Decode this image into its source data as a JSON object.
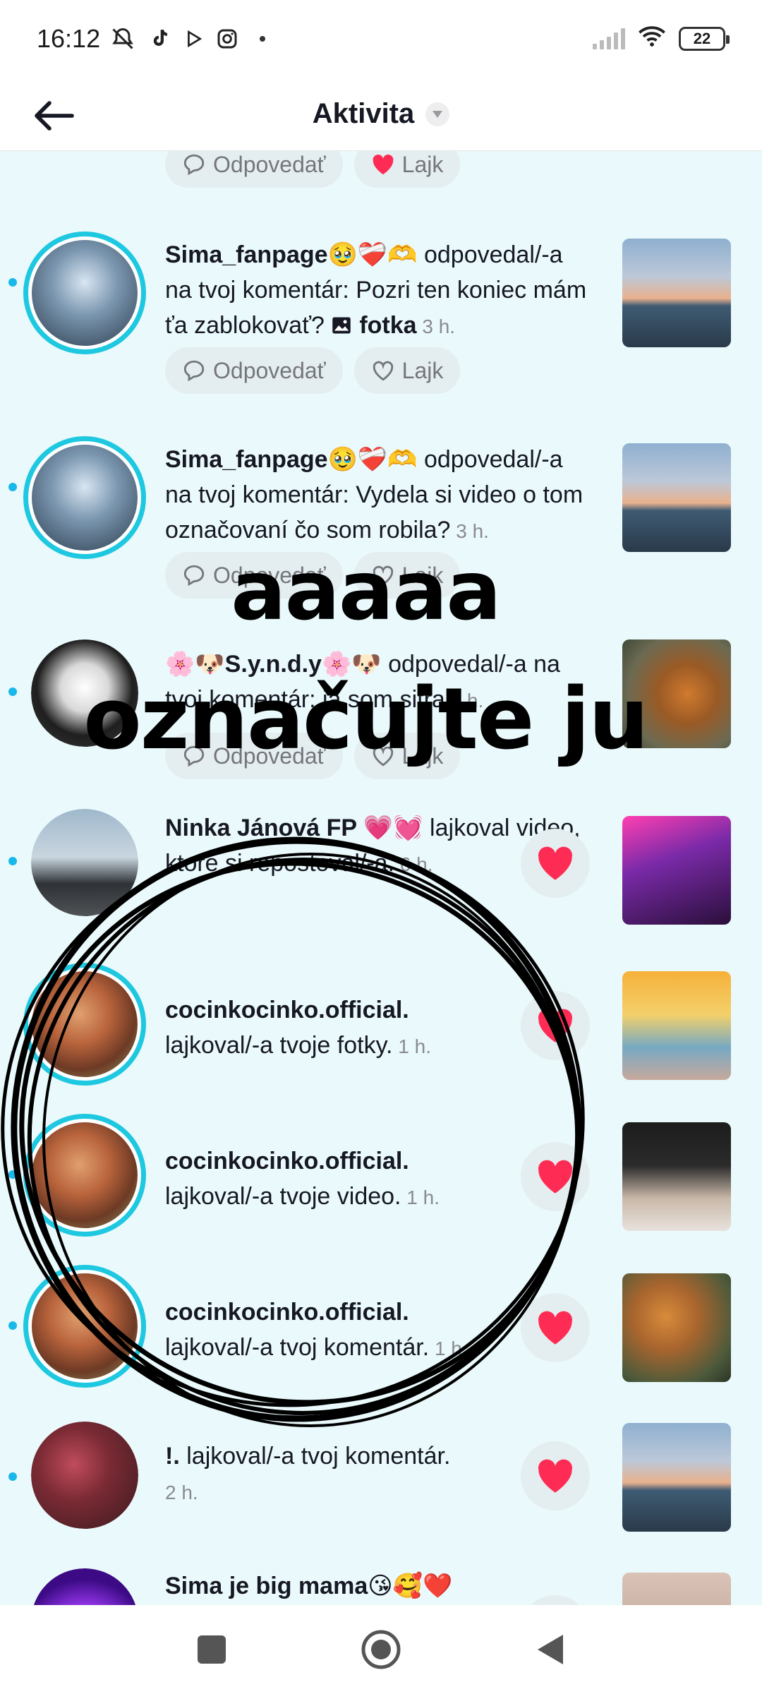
{
  "status_bar": {
    "time": "16:12",
    "icons": [
      "bell-muted-icon",
      "tiktok-icon",
      "play-icon",
      "instagram-icon"
    ],
    "battery": "22"
  },
  "header": {
    "title": "Aktivita"
  },
  "actions": {
    "reply_label": "Odpovedať",
    "like_label": "Lajk"
  },
  "notifications": [
    {
      "user": "Sima_fanpage🥹❤️‍🩹🫶",
      "text": " odpovedal/-a na tvoj komentár: Pozri ten koniec mám ťa zablokovať?",
      "media": " fotka",
      "time": " 3 h."
    },
    {
      "user": "Sima_fanpage🥹❤️‍🩹🫶",
      "text": " odpovedal/-a na tvoj komentár: Vydela si video o tom označovaní čo som robila?",
      "time": " 3 h."
    },
    {
      "user": "🌸🐶S.y.n.d.y🌸🐶",
      "text": " odpovedal/-a na tvoj komentár: já som sitra",
      "time": " 2 h."
    },
    {
      "user": "Ninka Jánová FP 💗💓",
      "text": " lajkoval video, ktoré si repostoval/-a.",
      "time": " 6 h."
    },
    {
      "user": "cocinkocinko.official.",
      "text": "lajkoval/-a tvoje fotky.",
      "time": " 1 h."
    },
    {
      "user": "cocinkocinko.official.",
      "text": "lajkoval/-a tvoje video.",
      "time": " 1 h."
    },
    {
      "user": "cocinkocinko.official.",
      "text": "lajkoval/-a tvoj komentár.",
      "time": " 1 h."
    },
    {
      "user": "!.",
      "text": " lajkoval/-a tvoj komentár.",
      "time": "2 h."
    },
    {
      "user": "Sima je big mama😘🥰❤️"
    }
  ],
  "overlay": {
    "line1": "aaaaa",
    "line2": "označujte ju"
  },
  "colors": {
    "background": "#eaf9fb",
    "ring": "#1ec8e0",
    "unread_dot": "#18b8ea",
    "heart_red": "#fe2c55",
    "pill_bg": "#e4eef0"
  }
}
